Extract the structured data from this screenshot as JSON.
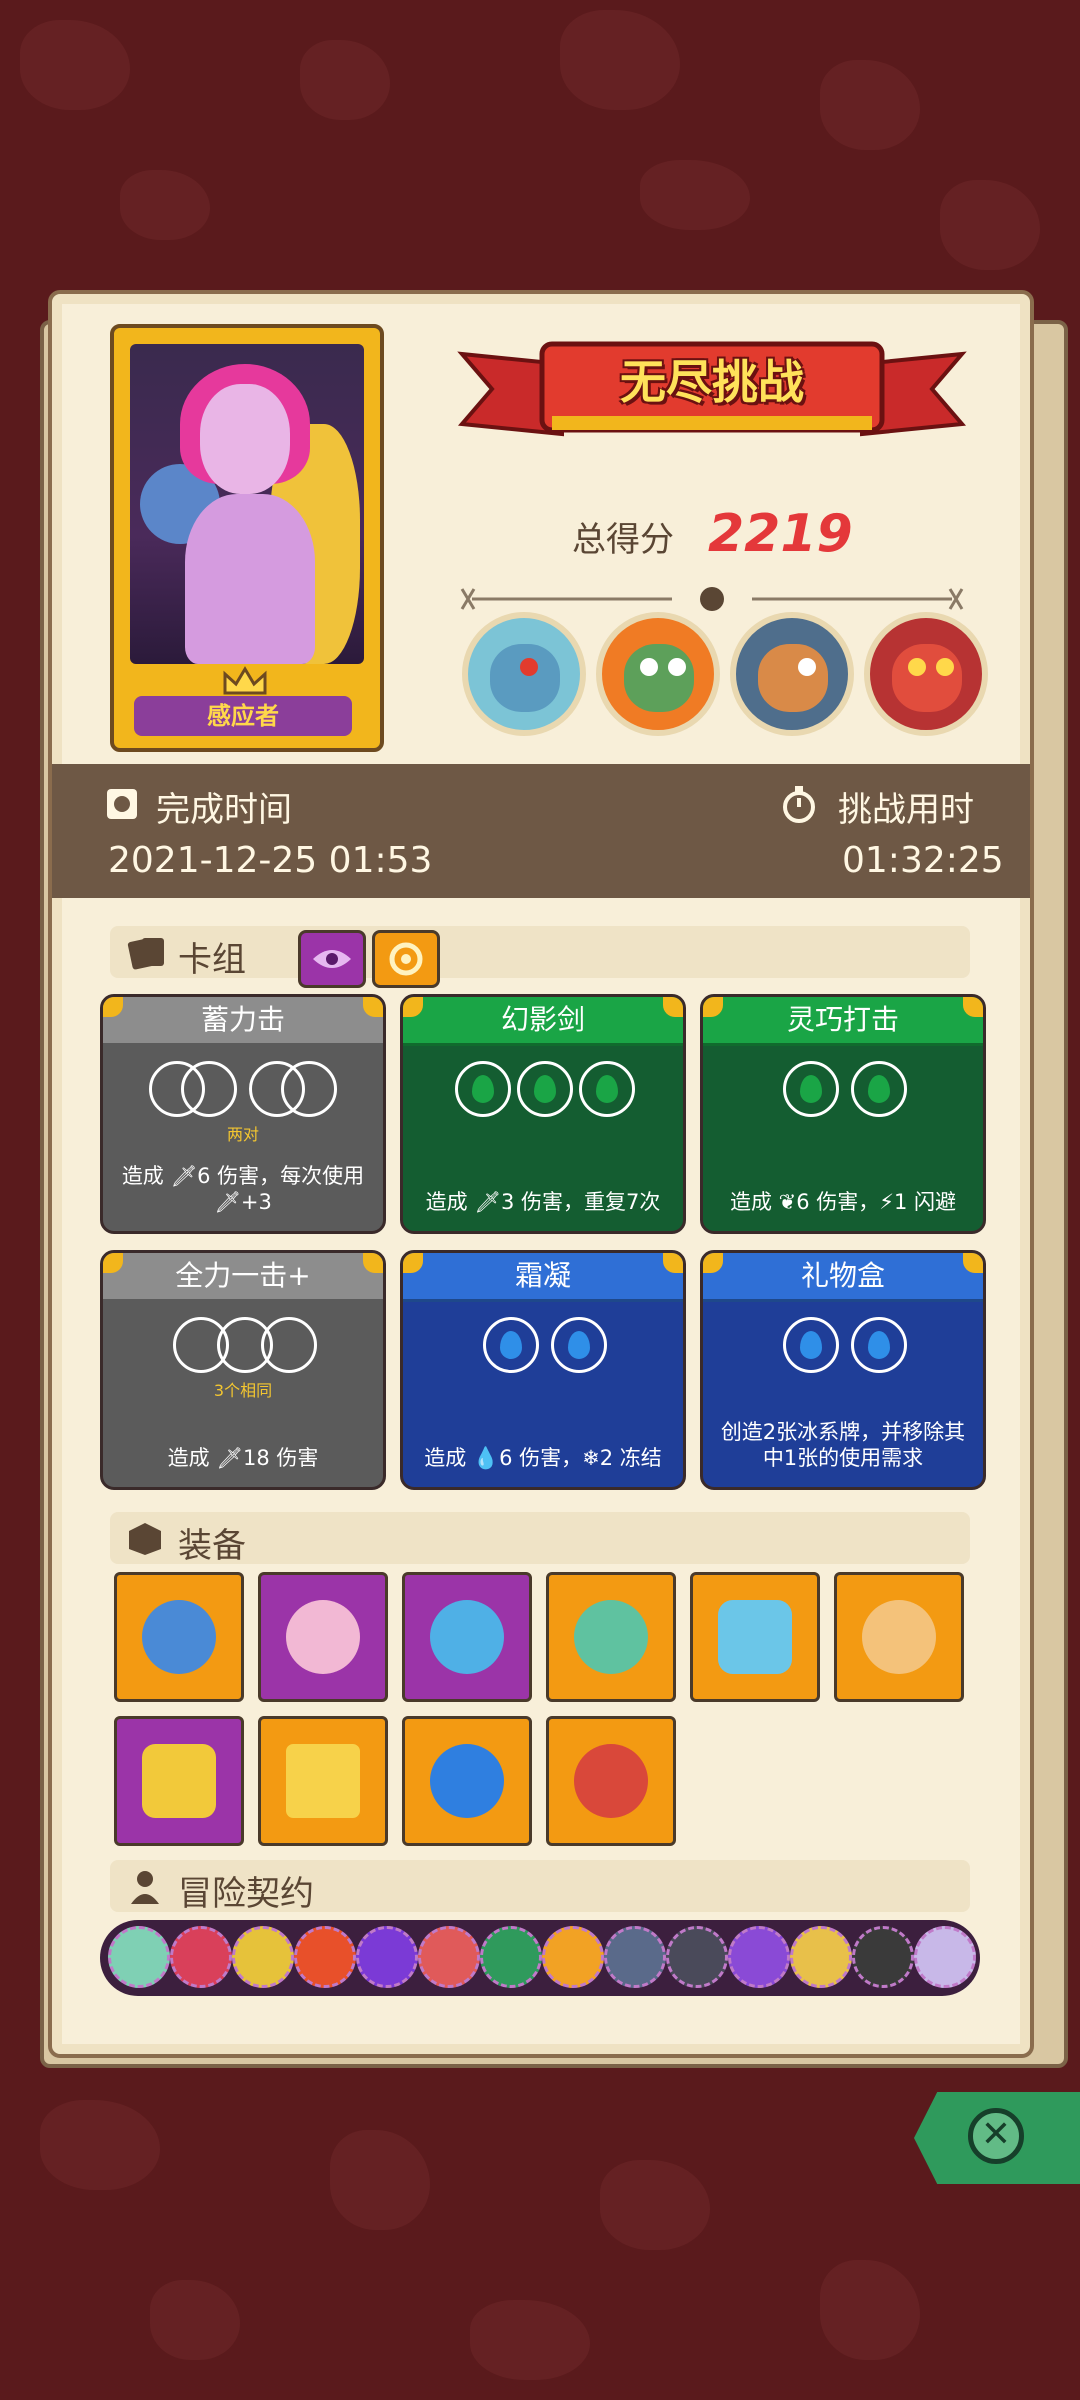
{
  "hero": {
    "name": "感应者"
  },
  "banner": {
    "title": "无尽挑战"
  },
  "score": {
    "label": "总得分",
    "value": "2219"
  },
  "time": {
    "complete_label": "完成时间",
    "complete_value": "2021-12-25 01:53",
    "duration_label": "挑战用时",
    "duration_value": "01:32:25"
  },
  "deck": {
    "title": "卡组",
    "cards": [
      {
        "name": "蓄力击",
        "requirement": "两对",
        "desc": "造成 🗡6 伤害，每次使用 🗡+3",
        "color": "grey"
      },
      {
        "name": "幻影剑",
        "requirement": "",
        "desc": "造成 🗡3 伤害，重复7次",
        "color": "green"
      },
      {
        "name": "灵巧打击",
        "requirement": "",
        "desc": "造成 ❦6 伤害，⚡1 闪避",
        "color": "green"
      },
      {
        "name": "全力一击+",
        "requirement": "3个相同",
        "desc": "造成 🗡18 伤害",
        "color": "grey"
      },
      {
        "name": "霜凝",
        "requirement": "",
        "desc": "造成 💧6 伤害，❄2 冻结",
        "color": "blue"
      },
      {
        "name": "礼物盒",
        "requirement": "",
        "desc": "创造2张冰系牌，并移除其中1张的使用需求",
        "color": "blue"
      }
    ]
  },
  "equipment": {
    "title": "装备"
  },
  "contracts": {
    "title": "冒险契约"
  },
  "colors": {
    "background": "#5a1a1c",
    "panel": "#f8efd9",
    "score": "#e4383a",
    "close_button": "#2f9a5c"
  }
}
